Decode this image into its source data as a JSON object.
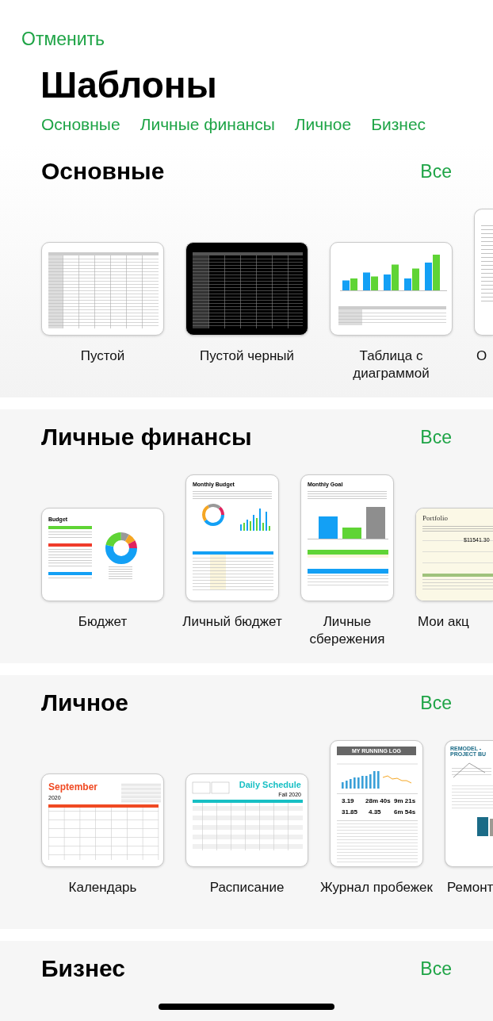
{
  "cancel": "Отменить",
  "title": "Шаблоны",
  "categories": [
    {
      "label": "Основные"
    },
    {
      "label": "Личные финансы"
    },
    {
      "label": "Личное"
    },
    {
      "label": "Бизнес"
    }
  ],
  "sections": [
    {
      "title": "Основные",
      "see_all": "Все",
      "templates": [
        {
          "kind": "grid",
          "label": "Пустой"
        },
        {
          "kind": "grid-dark",
          "label": "Пустой черный"
        },
        {
          "kind": "chart-table",
          "label": "Таблица с диаграммой"
        },
        {
          "kind": "text-doc",
          "label": "О"
        }
      ]
    },
    {
      "title": "Личные финансы",
      "see_all": "Все",
      "templates": [
        {
          "kind": "budget",
          "label": "Бюджет",
          "texts": [
            "Budget"
          ]
        },
        {
          "kind": "monthly-budget",
          "label": "Личный бюджет",
          "texts": [
            "Monthly Budget"
          ]
        },
        {
          "kind": "monthly-goal",
          "label": "Личные сбережения",
          "texts": [
            "Monthly Goal"
          ]
        },
        {
          "kind": "portfolio",
          "label": "Мои акц",
          "texts": [
            "Portfolio",
            "$11541.30"
          ]
        }
      ]
    },
    {
      "title": "Личное",
      "see_all": "Все",
      "templates": [
        {
          "kind": "calendar",
          "label": "Календарь",
          "texts": [
            "September",
            "2020"
          ]
        },
        {
          "kind": "schedule",
          "label": "Расписание",
          "texts": [
            "Daily Schedule",
            "Fall 2020"
          ]
        },
        {
          "kind": "running-log",
          "label": "Журнал пробежек",
          "texts": [
            "MY RUNNING LOG",
            "3.19",
            "28m 40s",
            "9m 21s",
            "31.85",
            "4.35",
            "6m 54s"
          ]
        },
        {
          "kind": "remodel",
          "label": "Ремонт",
          "texts": [
            "REMODEL - PROJECT BU"
          ]
        }
      ]
    },
    {
      "title": "Бизнес",
      "see_all": "Все"
    }
  ]
}
